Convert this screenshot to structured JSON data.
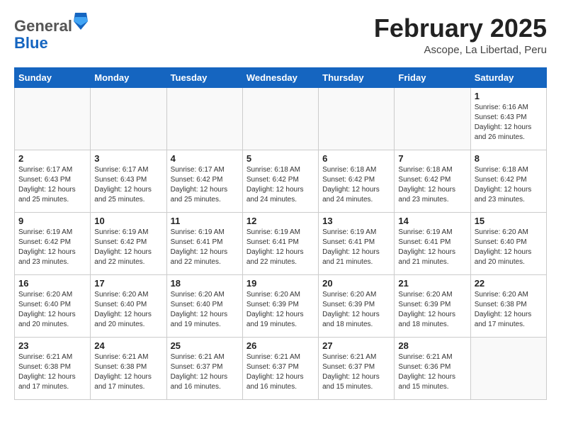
{
  "logo": {
    "general": "General",
    "blue": "Blue"
  },
  "header": {
    "month_year": "February 2025",
    "location": "Ascope, La Libertad, Peru"
  },
  "weekdays": [
    "Sunday",
    "Monday",
    "Tuesday",
    "Wednesday",
    "Thursday",
    "Friday",
    "Saturday"
  ],
  "weeks": [
    [
      {
        "day": "",
        "info": ""
      },
      {
        "day": "",
        "info": ""
      },
      {
        "day": "",
        "info": ""
      },
      {
        "day": "",
        "info": ""
      },
      {
        "day": "",
        "info": ""
      },
      {
        "day": "",
        "info": ""
      },
      {
        "day": "1",
        "info": "Sunrise: 6:16 AM\nSunset: 6:43 PM\nDaylight: 12 hours and 26 minutes."
      }
    ],
    [
      {
        "day": "2",
        "info": "Sunrise: 6:17 AM\nSunset: 6:43 PM\nDaylight: 12 hours and 25 minutes."
      },
      {
        "day": "3",
        "info": "Sunrise: 6:17 AM\nSunset: 6:43 PM\nDaylight: 12 hours and 25 minutes."
      },
      {
        "day": "4",
        "info": "Sunrise: 6:17 AM\nSunset: 6:42 PM\nDaylight: 12 hours and 25 minutes."
      },
      {
        "day": "5",
        "info": "Sunrise: 6:18 AM\nSunset: 6:42 PM\nDaylight: 12 hours and 24 minutes."
      },
      {
        "day": "6",
        "info": "Sunrise: 6:18 AM\nSunset: 6:42 PM\nDaylight: 12 hours and 24 minutes."
      },
      {
        "day": "7",
        "info": "Sunrise: 6:18 AM\nSunset: 6:42 PM\nDaylight: 12 hours and 23 minutes."
      },
      {
        "day": "8",
        "info": "Sunrise: 6:18 AM\nSunset: 6:42 PM\nDaylight: 12 hours and 23 minutes."
      }
    ],
    [
      {
        "day": "9",
        "info": "Sunrise: 6:19 AM\nSunset: 6:42 PM\nDaylight: 12 hours and 23 minutes."
      },
      {
        "day": "10",
        "info": "Sunrise: 6:19 AM\nSunset: 6:42 PM\nDaylight: 12 hours and 22 minutes."
      },
      {
        "day": "11",
        "info": "Sunrise: 6:19 AM\nSunset: 6:41 PM\nDaylight: 12 hours and 22 minutes."
      },
      {
        "day": "12",
        "info": "Sunrise: 6:19 AM\nSunset: 6:41 PM\nDaylight: 12 hours and 22 minutes."
      },
      {
        "day": "13",
        "info": "Sunrise: 6:19 AM\nSunset: 6:41 PM\nDaylight: 12 hours and 21 minutes."
      },
      {
        "day": "14",
        "info": "Sunrise: 6:19 AM\nSunset: 6:41 PM\nDaylight: 12 hours and 21 minutes."
      },
      {
        "day": "15",
        "info": "Sunrise: 6:20 AM\nSunset: 6:40 PM\nDaylight: 12 hours and 20 minutes."
      }
    ],
    [
      {
        "day": "16",
        "info": "Sunrise: 6:20 AM\nSunset: 6:40 PM\nDaylight: 12 hours and 20 minutes."
      },
      {
        "day": "17",
        "info": "Sunrise: 6:20 AM\nSunset: 6:40 PM\nDaylight: 12 hours and 20 minutes."
      },
      {
        "day": "18",
        "info": "Sunrise: 6:20 AM\nSunset: 6:40 PM\nDaylight: 12 hours and 19 minutes."
      },
      {
        "day": "19",
        "info": "Sunrise: 6:20 AM\nSunset: 6:39 PM\nDaylight: 12 hours and 19 minutes."
      },
      {
        "day": "20",
        "info": "Sunrise: 6:20 AM\nSunset: 6:39 PM\nDaylight: 12 hours and 18 minutes."
      },
      {
        "day": "21",
        "info": "Sunrise: 6:20 AM\nSunset: 6:39 PM\nDaylight: 12 hours and 18 minutes."
      },
      {
        "day": "22",
        "info": "Sunrise: 6:20 AM\nSunset: 6:38 PM\nDaylight: 12 hours and 17 minutes."
      }
    ],
    [
      {
        "day": "23",
        "info": "Sunrise: 6:21 AM\nSunset: 6:38 PM\nDaylight: 12 hours and 17 minutes."
      },
      {
        "day": "24",
        "info": "Sunrise: 6:21 AM\nSunset: 6:38 PM\nDaylight: 12 hours and 17 minutes."
      },
      {
        "day": "25",
        "info": "Sunrise: 6:21 AM\nSunset: 6:37 PM\nDaylight: 12 hours and 16 minutes."
      },
      {
        "day": "26",
        "info": "Sunrise: 6:21 AM\nSunset: 6:37 PM\nDaylight: 12 hours and 16 minutes."
      },
      {
        "day": "27",
        "info": "Sunrise: 6:21 AM\nSunset: 6:37 PM\nDaylight: 12 hours and 15 minutes."
      },
      {
        "day": "28",
        "info": "Sunrise: 6:21 AM\nSunset: 6:36 PM\nDaylight: 12 hours and 15 minutes."
      },
      {
        "day": "",
        "info": ""
      }
    ]
  ]
}
